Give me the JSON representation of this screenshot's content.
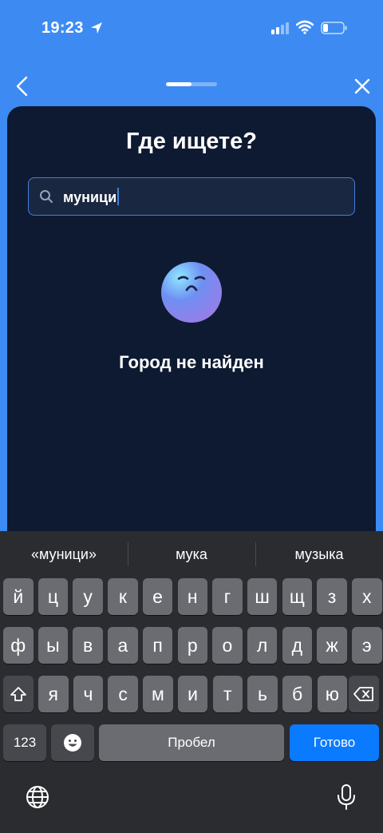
{
  "status_bar": {
    "time": "19:23"
  },
  "onboarding": {
    "step": 1,
    "total_steps": 2
  },
  "page": {
    "title": "Где ищете?"
  },
  "search": {
    "value": "муници"
  },
  "empty_state": {
    "text": "Город не найден"
  },
  "keyboard": {
    "suggestions": [
      "«муници»",
      "мука",
      "музыка"
    ],
    "rows": [
      [
        "й",
        "ц",
        "у",
        "к",
        "е",
        "н",
        "г",
        "ш",
        "щ",
        "з",
        "х"
      ],
      [
        "ф",
        "ы",
        "в",
        "а",
        "п",
        "р",
        "о",
        "л",
        "д",
        "ж",
        "э"
      ],
      [
        "я",
        "ч",
        "с",
        "м",
        "и",
        "т",
        "ь",
        "б",
        "ю"
      ]
    ],
    "numbers_key": "123",
    "space_key": "Пробел",
    "done_key": "Готово"
  },
  "colors": {
    "background": "#3d8bf2",
    "card": "#0e1a32",
    "accent": "#3f7fe0",
    "keyboard": "#2b2c30",
    "done_key": "#0a7aff"
  }
}
